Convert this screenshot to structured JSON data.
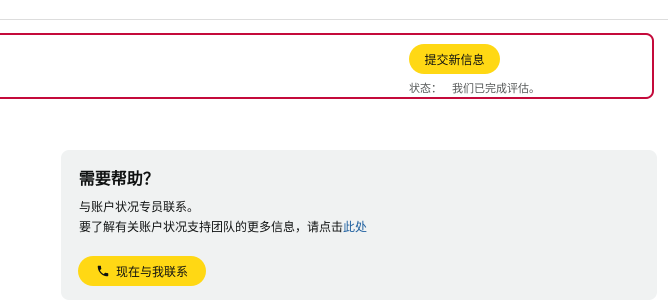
{
  "status_card": {
    "submit_button_label": "提交新信息",
    "status_label": "状态：",
    "status_value": "我们已完成评估。"
  },
  "help": {
    "title": "需要帮助？",
    "line1": "与账户状况专员联系。",
    "line2_prefix": "要了解有关账户状况支持团队的更多信息，请点击",
    "line2_link": "此处",
    "contact_button_label": "现在与我联系",
    "contact_button_icon": "phone-icon"
  },
  "colors": {
    "accent_button": "#ffd814",
    "alert_border": "#c40a3b",
    "link": "#2162a1",
    "panel_bg": "#f0f2f2"
  }
}
